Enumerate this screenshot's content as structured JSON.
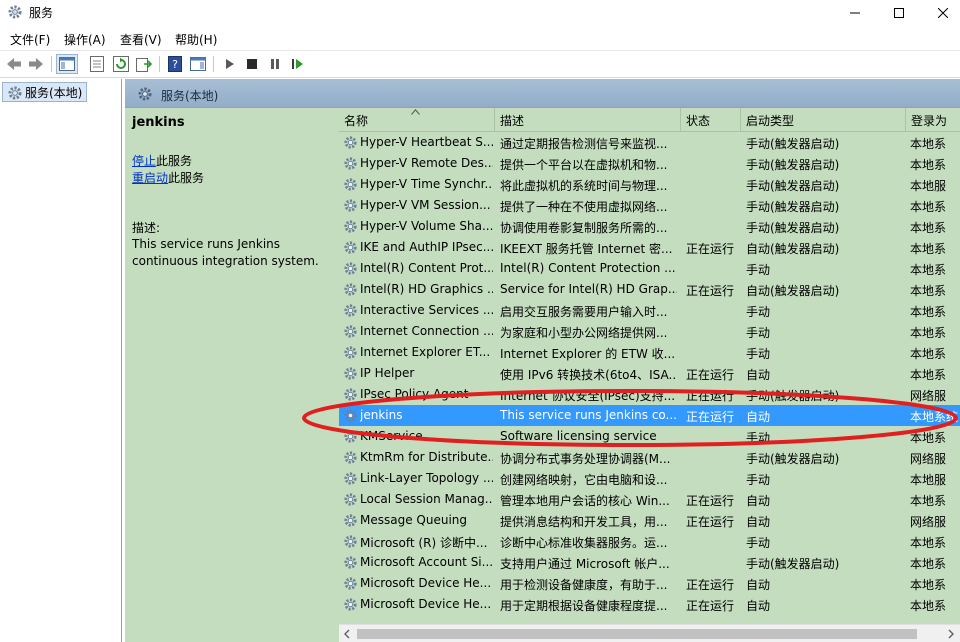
{
  "window": {
    "title": "服务"
  },
  "menu": [
    "文件(F)",
    "操作(A)",
    "查看(V)",
    "帮助(H)"
  ],
  "tree": {
    "root_label": "服务(本地)"
  },
  "main": {
    "header_label": "服务(本地)",
    "selected_name": "jenkins",
    "stop_link": "停止",
    "stop_suffix": "此服务",
    "restart_link": "重启动",
    "restart_suffix": "此服务",
    "desc_label": "描述:",
    "desc_text": "This service runs Jenkins continuous integration system."
  },
  "list": {
    "columns": [
      "名称",
      "描述",
      "状态",
      "启动类型",
      "登录为"
    ],
    "rows": [
      {
        "name": "Hyper-V Heartbeat S...",
        "desc": "通过定期报告检测信号来监视...",
        "status": "",
        "startup": "手动(触发器启动)",
        "logon": "本地系"
      },
      {
        "name": "Hyper-V Remote Des...",
        "desc": "提供一个平台以在虚拟机和物...",
        "status": "",
        "startup": "手动(触发器启动)",
        "logon": "本地系"
      },
      {
        "name": "Hyper-V Time Synchr...",
        "desc": "将此虚拟机的系统时间与物理...",
        "status": "",
        "startup": "手动(触发器启动)",
        "logon": "本地服"
      },
      {
        "name": "Hyper-V VM Session...",
        "desc": "提供了一种在不使用虚拟网络...",
        "status": "",
        "startup": "手动(触发器启动)",
        "logon": "本地系"
      },
      {
        "name": "Hyper-V Volume Sha...",
        "desc": "协调使用卷影复制服务所需的...",
        "status": "",
        "startup": "手动(触发器启动)",
        "logon": "本地系"
      },
      {
        "name": "IKE and AuthIP IPsec...",
        "desc": "IKEEXT 服务托管 Internet 密...",
        "status": "正在运行",
        "startup": "自动(触发器启动)",
        "logon": "本地系"
      },
      {
        "name": "Intel(R) Content Prot...",
        "desc": "Intel(R) Content Protection ...",
        "status": "",
        "startup": "手动",
        "logon": "本地系"
      },
      {
        "name": "Intel(R) HD Graphics ...",
        "desc": "Service for Intel(R) HD Grap...",
        "status": "正在运行",
        "startup": "自动(触发器启动)",
        "logon": "本地系"
      },
      {
        "name": "Interactive Services ...",
        "desc": "启用交互服务需要用户输入时...",
        "status": "",
        "startup": "手动",
        "logon": "本地系"
      },
      {
        "name": "Internet Connection ...",
        "desc": "为家庭和小型办公网络提供网...",
        "status": "",
        "startup": "手动",
        "logon": "本地系"
      },
      {
        "name": "Internet Explorer ET...",
        "desc": "Internet Explorer 的 ETW 收...",
        "status": "",
        "startup": "手动",
        "logon": "本地系"
      },
      {
        "name": "IP Helper",
        "desc": "使用 IPv6 转换技术(6to4、ISA...",
        "status": "正在运行",
        "startup": "自动",
        "logon": "本地系"
      },
      {
        "name": "IPsec Policy Agent",
        "desc": "Internet 协议安全(IPsec)支持...",
        "status": "正在运行",
        "startup": "手动(触发器启动)",
        "logon": "网络服"
      },
      {
        "name": "jenkins",
        "desc": "This service runs Jenkins co...",
        "status": "正在运行",
        "startup": "自动",
        "logon": "本地系统",
        "selected": true
      },
      {
        "name": "KMService",
        "desc": "Software licensing service",
        "status": "",
        "startup": "手动",
        "logon": "本地系"
      },
      {
        "name": "KtmRm for Distribute...",
        "desc": "协调分布式事务处理协调器(M...",
        "status": "",
        "startup": "手动(触发器启动)",
        "logon": "网络服"
      },
      {
        "name": "Link-Layer Topology ...",
        "desc": "创建网络映射，它由电脑和设...",
        "status": "",
        "startup": "手动",
        "logon": "本地服"
      },
      {
        "name": "Local Session Manag...",
        "desc": "管理本地用户会话的核心 Win...",
        "status": "正在运行",
        "startup": "自动",
        "logon": "本地系"
      },
      {
        "name": "Message Queuing",
        "desc": "提供消息结构和开发工具，用...",
        "status": "正在运行",
        "startup": "自动",
        "logon": "网络服"
      },
      {
        "name": "Microsoft (R) 诊断中...",
        "desc": "诊断中心标准收集器服务。运...",
        "status": "",
        "startup": "手动",
        "logon": "本地系"
      },
      {
        "name": "Microsoft Account Si...",
        "desc": "支持用户通过 Microsoft 帐户...",
        "status": "",
        "startup": "手动(触发器启动)",
        "logon": "本地系"
      },
      {
        "name": "Microsoft Device He...",
        "desc": "用于检测设备健康度，有助于...",
        "status": "正在运行",
        "startup": "自动",
        "logon": "本地系"
      },
      {
        "name": "Microsoft Device He...",
        "desc": "用于定期根据设备健康程度提...",
        "status": "正在运行",
        "startup": "自动",
        "logon": "本地系"
      }
    ]
  }
}
